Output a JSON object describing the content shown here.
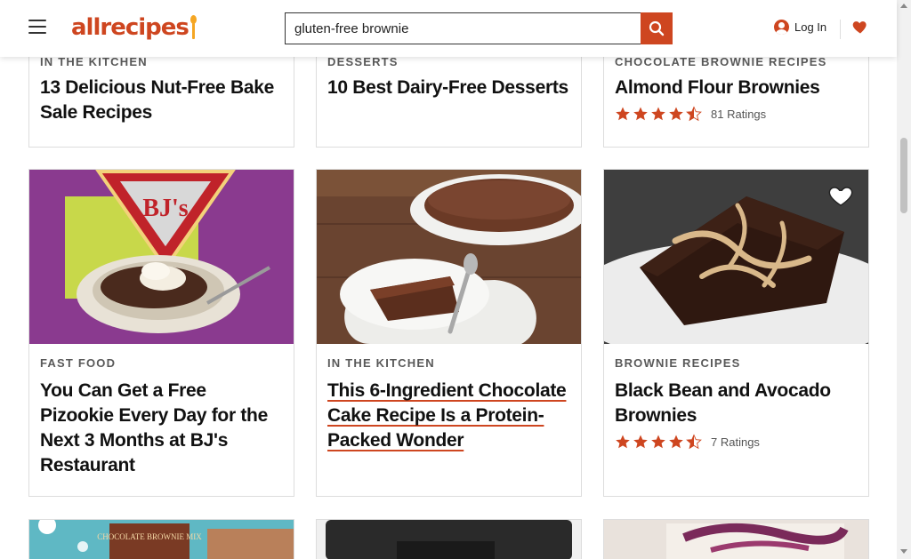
{
  "header": {
    "logo_text": "allrecipes",
    "search_value": "gluten-free brownie",
    "login_label": "Log In"
  },
  "top_cards": [
    {
      "eyebrow": "IN THE KITCHEN",
      "title": "13 Delicious Nut-Free Bake Sale Recipes"
    },
    {
      "eyebrow": "DESSERTS",
      "title": "10 Best Dairy-Free Desserts"
    },
    {
      "eyebrow": "CHOCOLATE BROWNIE RECIPES",
      "title": "Almond Flour Brownies",
      "rating": 4.5,
      "rating_count": "81 Ratings"
    }
  ],
  "cards": [
    {
      "eyebrow": "FAST FOOD",
      "title": "You Can Get a Free Pizookie Every Day for the Next 3 Months at BJ's Restaurant",
      "image_label": "BJ's"
    },
    {
      "eyebrow": "IN THE KITCHEN",
      "title": "This 6-Ingredient Chocolate Cake Recipe Is a Protein-Packed Wonder"
    },
    {
      "eyebrow": "BROWNIE RECIPES",
      "title": "Black Bean and Avocado Brownies",
      "rating": 4.5,
      "rating_count": "7 Ratings"
    }
  ],
  "bottom_cards": [
    {
      "image_label": "CHOCOLATE BROWNIE MIX"
    }
  ],
  "colors": {
    "brand": "#ce4620",
    "star": "#ce4620",
    "text": "#111111",
    "muted": "#595959"
  },
  "icons": {
    "menu": "hamburger-icon",
    "search": "search-icon",
    "user": "user-icon",
    "favorites": "heart-icon"
  }
}
